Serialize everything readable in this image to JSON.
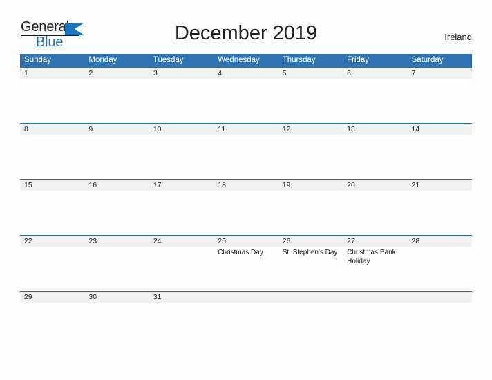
{
  "brand": {
    "name_part1": "General",
    "name_part2": "Blue",
    "logo_icon": "blue-triangle-icon",
    "accent_color": "#1b75bc"
  },
  "header": {
    "title": "December 2019",
    "region": "Ireland"
  },
  "theme": {
    "header_blue": "#2e74b5",
    "band_gray": "#f1f1f1",
    "page_background": "#fdfdfd",
    "text": "#231f20"
  },
  "calendar": {
    "weekdays": [
      "Sunday",
      "Monday",
      "Tuesday",
      "Wednesday",
      "Thursday",
      "Friday",
      "Saturday"
    ],
    "weeks": [
      [
        {
          "day": "1",
          "events": []
        },
        {
          "day": "2",
          "events": []
        },
        {
          "day": "3",
          "events": []
        },
        {
          "day": "4",
          "events": []
        },
        {
          "day": "5",
          "events": []
        },
        {
          "day": "6",
          "events": []
        },
        {
          "day": "7",
          "events": []
        }
      ],
      [
        {
          "day": "8",
          "events": []
        },
        {
          "day": "9",
          "events": []
        },
        {
          "day": "10",
          "events": []
        },
        {
          "day": "11",
          "events": []
        },
        {
          "day": "12",
          "events": []
        },
        {
          "day": "13",
          "events": []
        },
        {
          "day": "14",
          "events": []
        }
      ],
      [
        {
          "day": "15",
          "events": []
        },
        {
          "day": "16",
          "events": []
        },
        {
          "day": "17",
          "events": []
        },
        {
          "day": "18",
          "events": []
        },
        {
          "day": "19",
          "events": []
        },
        {
          "day": "20",
          "events": []
        },
        {
          "day": "21",
          "events": []
        }
      ],
      [
        {
          "day": "22",
          "events": []
        },
        {
          "day": "23",
          "events": []
        },
        {
          "day": "24",
          "events": []
        },
        {
          "day": "25",
          "events": [
            "Christmas Day"
          ]
        },
        {
          "day": "26",
          "events": [
            "St. Stephen's Day"
          ]
        },
        {
          "day": "27",
          "events": [
            "Christmas Bank Holiday"
          ]
        },
        {
          "day": "28",
          "events": []
        }
      ],
      [
        {
          "day": "29",
          "events": []
        },
        {
          "day": "30",
          "events": []
        },
        {
          "day": "31",
          "events": []
        },
        {
          "day": "",
          "events": []
        },
        {
          "day": "",
          "events": []
        },
        {
          "day": "",
          "events": []
        },
        {
          "day": "",
          "events": []
        }
      ]
    ]
  }
}
